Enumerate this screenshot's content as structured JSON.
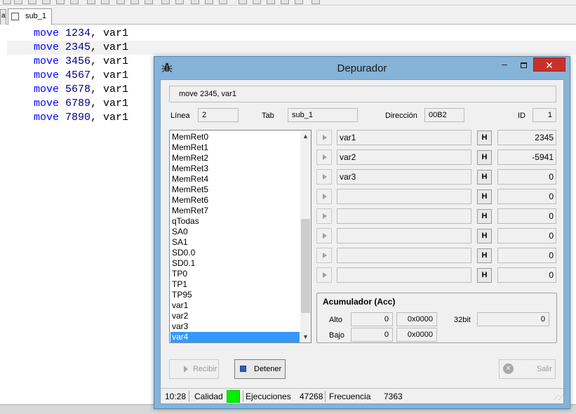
{
  "editor": {
    "tab_label": "sub_1",
    "left_tab_fragment": "al",
    "lines": [
      {
        "keyword": "move",
        "number": "1234",
        "rest": ", var1"
      },
      {
        "keyword": "move",
        "number": "2345",
        "rest": ", var1"
      },
      {
        "keyword": "move",
        "number": "3456",
        "rest": ", var1"
      },
      {
        "keyword": "move",
        "number": "4567",
        "rest": ", var1"
      },
      {
        "keyword": "move",
        "number": "5678",
        "rest": ", var1"
      },
      {
        "keyword": "move",
        "number": "6789",
        "rest": ", var1"
      },
      {
        "keyword": "move",
        "number": "7890",
        "rest": ", var1"
      }
    ],
    "current_line": 2
  },
  "debugger": {
    "title": "Depurador",
    "title_icon": "bug-icon",
    "minimize_glyph": "–",
    "close_glyph": "✕",
    "instruction": "move 2345, var1",
    "linea_label": "Línea",
    "linea_value": "2",
    "tab_label": "Tab",
    "tab_value": "sub_1",
    "direccion_label": "Dirección",
    "direccion_value": "00B2",
    "id_label": "ID",
    "id_value": "1",
    "list_items": [
      "MemRet0",
      "MemRet1",
      "MemRet2",
      "MemRet3",
      "MemRet4",
      "MemRet5",
      "MemRet6",
      "MemRet7",
      "qTodas",
      "SA0",
      "SA1",
      "SD0.0",
      "SD0.1",
      "TP0",
      "TP1",
      "TP95",
      "var1",
      "var2",
      "var3",
      "var4"
    ],
    "selected_item": "var4",
    "variables": [
      {
        "name": "var1",
        "h": "H",
        "value": "2345"
      },
      {
        "name": "var2",
        "h": "H",
        "value": "-5941"
      },
      {
        "name": "var3",
        "h": "H",
        "value": "0"
      },
      {
        "name": "",
        "h": "H",
        "value": "0"
      },
      {
        "name": "",
        "h": "H",
        "value": "0"
      },
      {
        "name": "",
        "h": "H",
        "value": "0"
      },
      {
        "name": "",
        "h": "H",
        "value": "0"
      },
      {
        "name": "",
        "h": "H",
        "value": "0"
      }
    ],
    "accumulator": {
      "title": "Acumulador (Acc)",
      "alto_label": "Alto",
      "alto_dec": "0",
      "alto_hex": "0x0000",
      "bit32_label": "32bit",
      "bit32_value": "0",
      "bajo_label": "Bajo",
      "bajo_dec": "0",
      "bajo_hex": "0x0000"
    },
    "buttons": {
      "recibir": "Recibir",
      "detener": "Detener",
      "salir": "Salir"
    },
    "status": {
      "time": "10:28",
      "calidad_label": "Calidad",
      "quality_color": "#00ee00",
      "ejecuciones_label": "Ejecuciones",
      "ejecuciones_value": "47268",
      "frecuencia_label": "Frecuencia",
      "frecuencia_value": "7363"
    }
  }
}
